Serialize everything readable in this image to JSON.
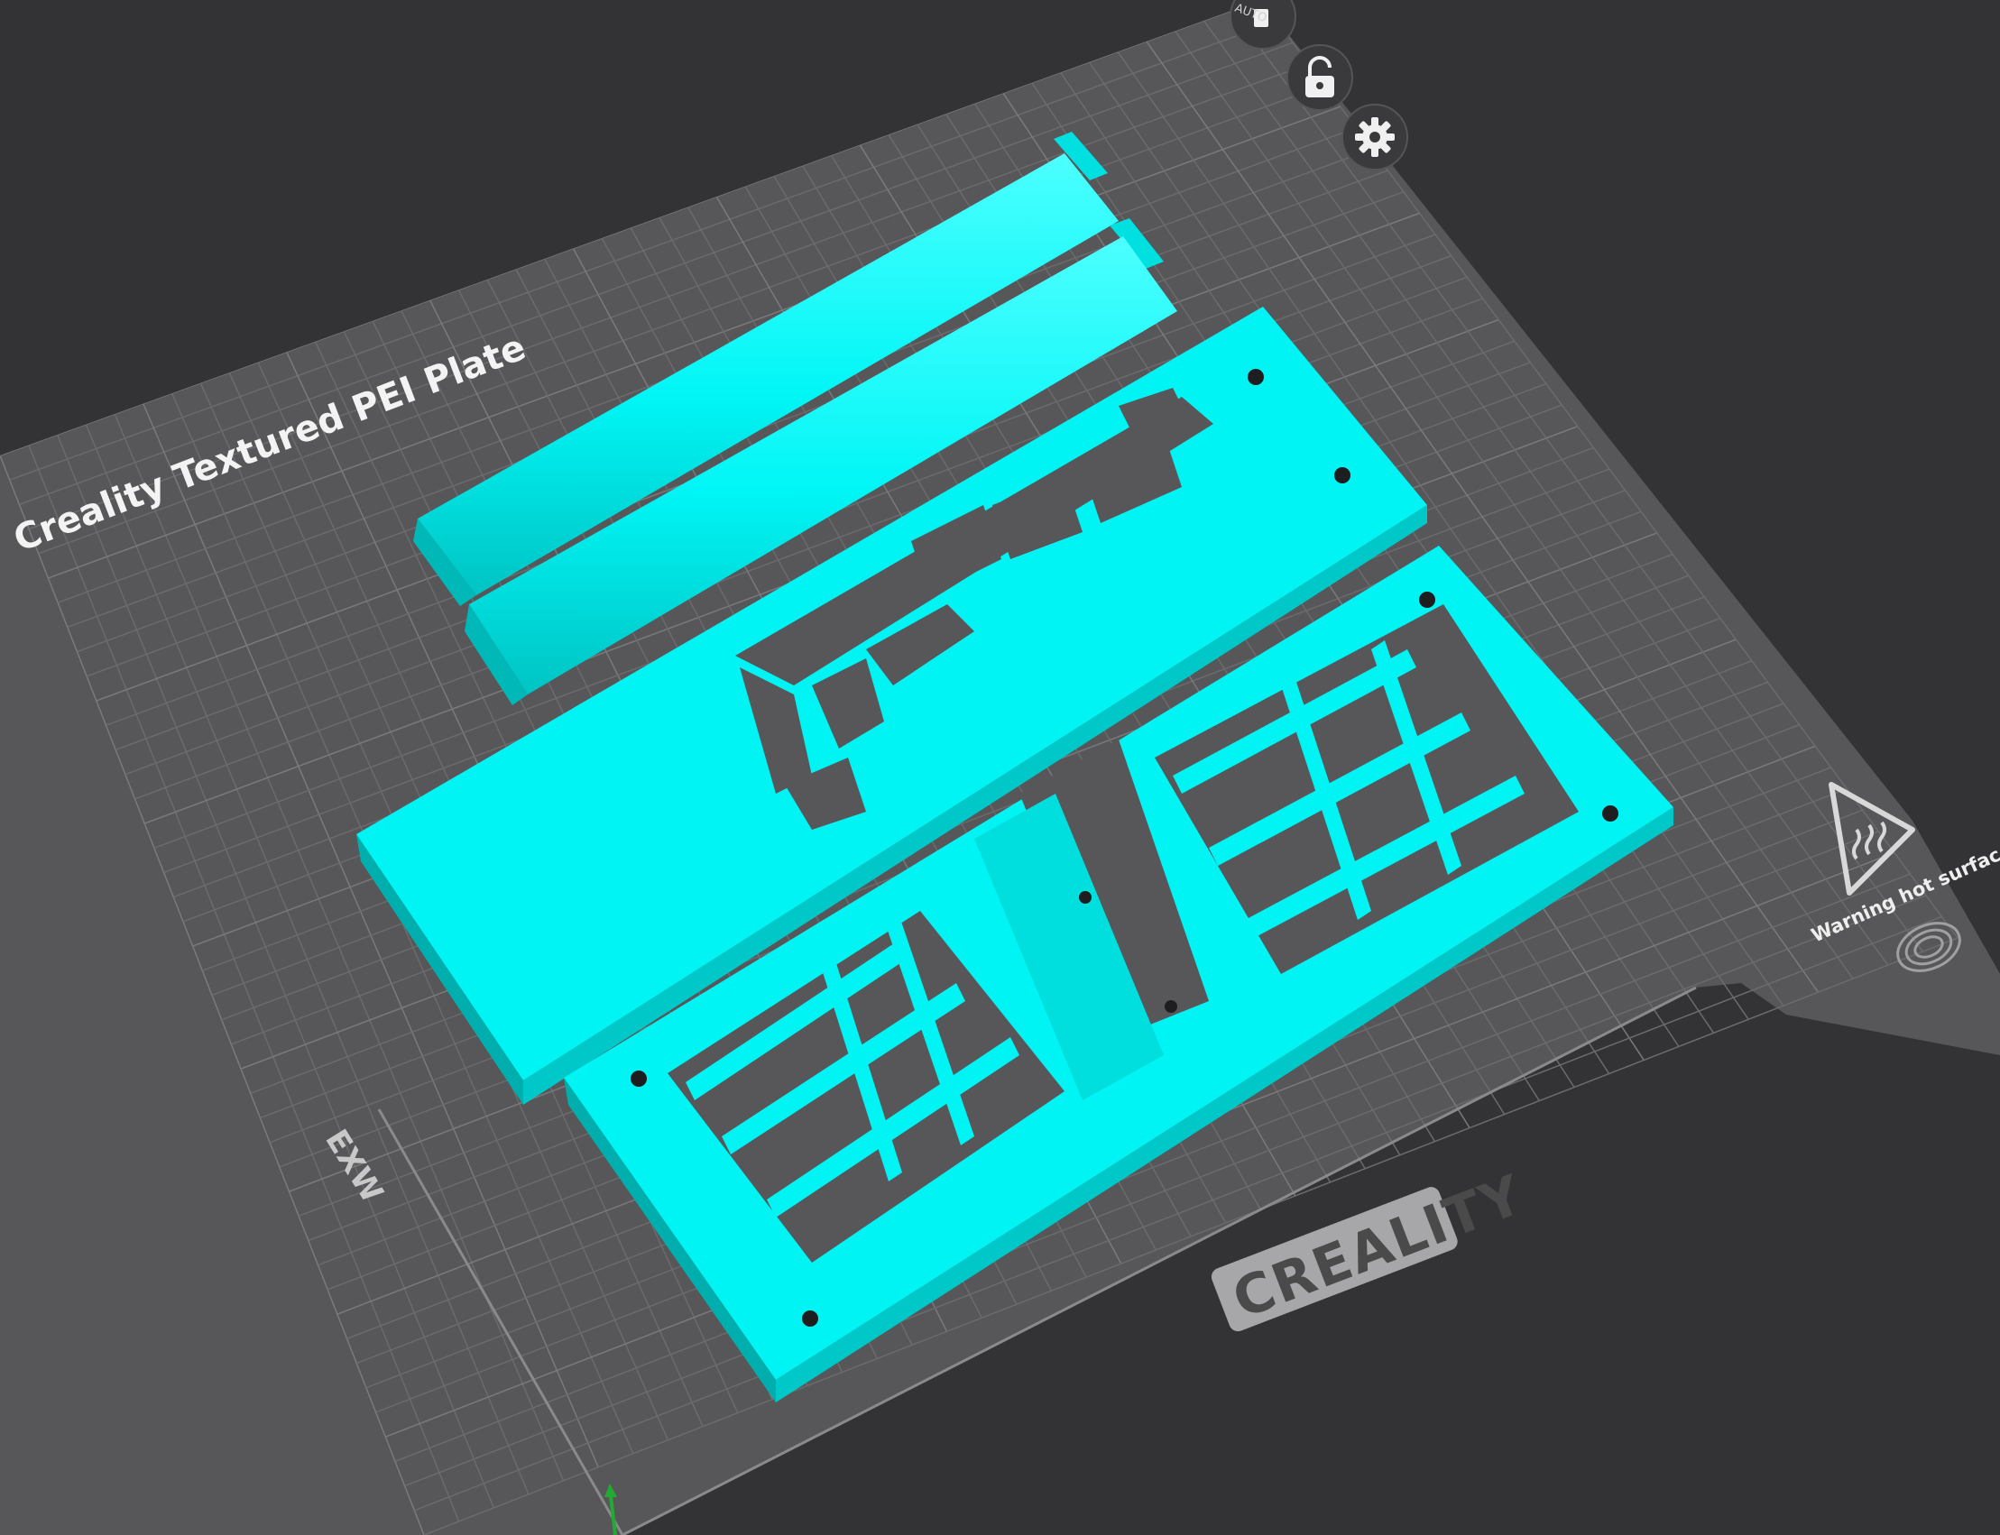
{
  "viewport": {
    "plate_name": "Creality Textured PEI Plate",
    "brand": "CREALITY",
    "warning": "Warning hot surface",
    "auto_label": "AUTO",
    "axis_label": "EXW"
  },
  "toolbar": {
    "auto_arrange": "auto-arrange-button",
    "lock": "lock-button",
    "settings": "settings-button"
  },
  "colors": {
    "background": "#333336",
    "plate": "#575759",
    "grid": "#6c6c6e",
    "model": "#00fefe",
    "model_dark": "#00a8a8",
    "text": "#f3f3f3"
  }
}
